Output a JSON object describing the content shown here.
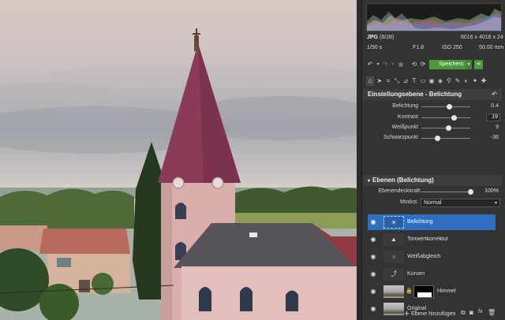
{
  "image_info": {
    "format": "JPG",
    "position": "(8/28)",
    "dimensions": "6016 x 4016 x 24",
    "shutter": "1/90 s",
    "aperture": "F1.8",
    "iso": "ISO 250",
    "focal": "50.00 mm"
  },
  "toolbar": {
    "save_label": "Speichern"
  },
  "adjustment": {
    "title": "Einstellungsebene - Belichtung",
    "sliders": [
      {
        "label": "Belichtung",
        "value": "0.4",
        "fraction": 0.56
      },
      {
        "label": "Kontrast",
        "value": "19",
        "fraction": 0.66
      },
      {
        "label": "Weißpunkt",
        "value": "9",
        "fraction": 0.55
      },
      {
        "label": "Schwarzpunkt",
        "value": "-36",
        "fraction": 0.32
      }
    ]
  },
  "layers_panel": {
    "title": "Ebenen (Belichtung)",
    "opacity_label": "Ebenendeckkraft:",
    "opacity_value": "100%",
    "opacity_fraction": 1.0,
    "mode_label": "Modus:",
    "mode_value": "Normal",
    "layers": [
      {
        "name": "Belichtung",
        "icon": "sun-icon",
        "selected": true
      },
      {
        "name": "Tonwertkorrektur",
        "icon": "levels-icon",
        "selected": false
      },
      {
        "name": "Weißabgleich",
        "icon": "bulb-icon",
        "selected": false
      },
      {
        "name": "Kurven",
        "icon": "curve-icon",
        "selected": false
      },
      {
        "name": "Himmel",
        "icon": "photo-thumb",
        "selected": false
      },
      {
        "name": "Original",
        "icon": "photo-thumb",
        "selected": false
      }
    ],
    "add_label": "Ebene hinzufügen"
  },
  "colors": {
    "panel_bg": "#333333",
    "accent_blue": "#2f6fc0",
    "save_green": "#4a9a3a"
  }
}
